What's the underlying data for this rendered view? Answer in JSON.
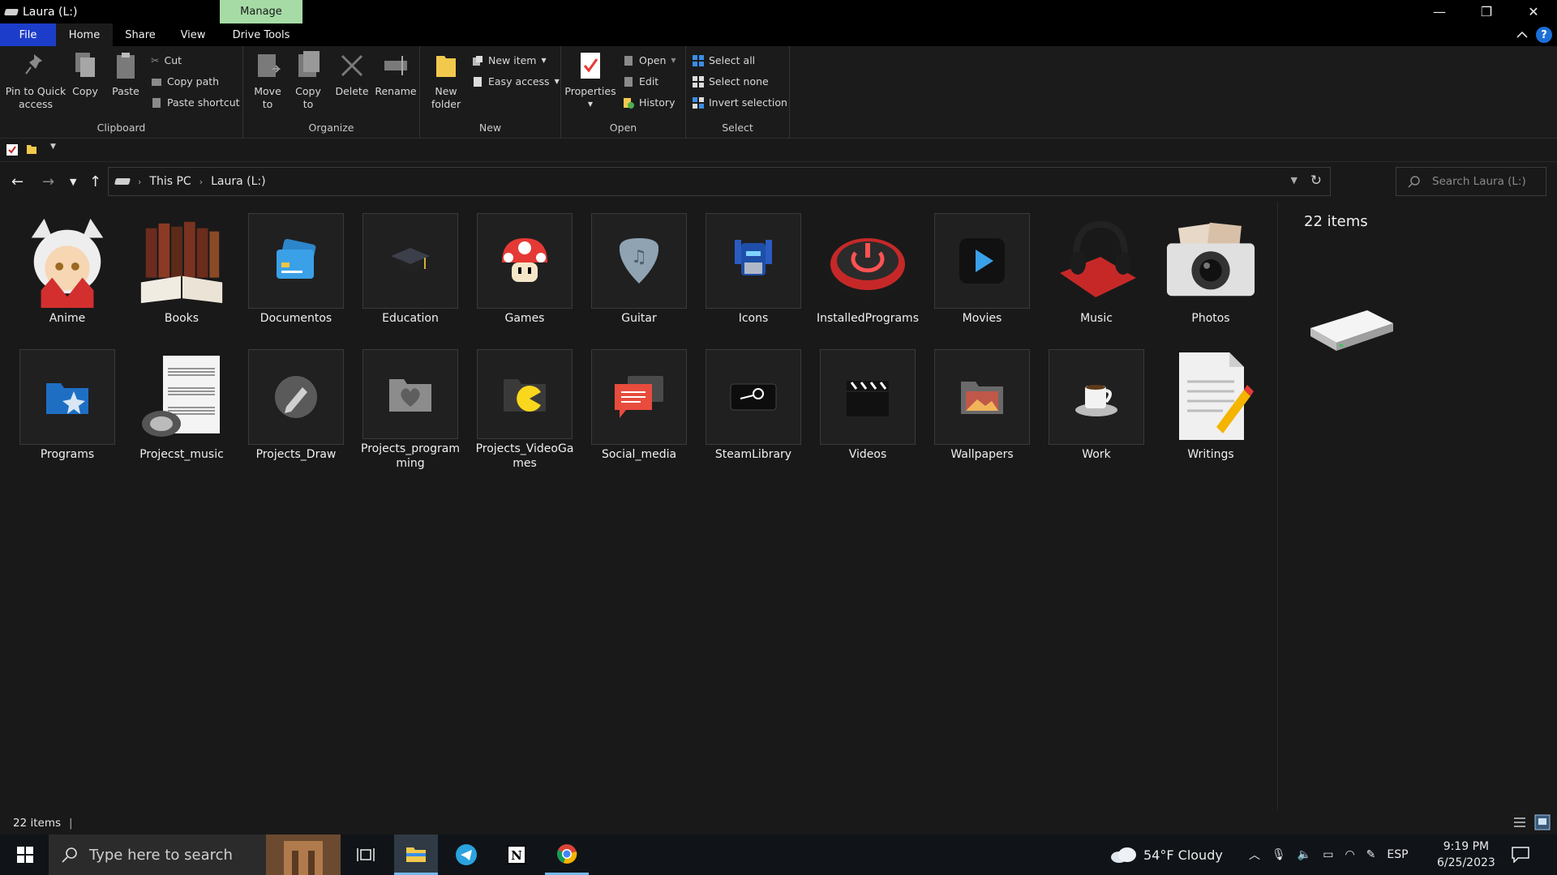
{
  "window": {
    "title": "Laura (L:)",
    "context_tab": "Manage",
    "minimize_glyph": "—",
    "maximize_glyph": "❐",
    "close_glyph": "✕"
  },
  "ribbon_tabs": [
    "File",
    "Home",
    "Share",
    "View",
    "Drive Tools"
  ],
  "ribbon": {
    "clipboard": {
      "label": "Clipboard",
      "pin_line1": "Pin to Quick",
      "pin_line2": "access",
      "copy": "Copy",
      "paste": "Paste",
      "cut": "Cut",
      "copy_path": "Copy path",
      "paste_shortcut": "Paste shortcut"
    },
    "organize": {
      "label": "Organize",
      "move_line1": "Move",
      "move_line2": "to",
      "copyto_line1": "Copy",
      "copyto_line2": "to",
      "delete": "Delete",
      "rename": "Rename"
    },
    "new": {
      "label": "New",
      "folder_line1": "New",
      "folder_line2": "folder",
      "new_item": "New item",
      "easy_access": "Easy access"
    },
    "open": {
      "label": "Open",
      "properties": "Properties",
      "open": "Open",
      "edit": "Edit",
      "history": "History"
    },
    "select": {
      "label": "Select",
      "select_all": "Select all",
      "select_none": "Select none",
      "invert": "Invert selection"
    }
  },
  "address": {
    "crumbs": [
      "This PC",
      "Laura (L:)"
    ],
    "search_placeholder": "Search Laura (L:)"
  },
  "items": [
    {
      "name": "Anime",
      "icon": "anime-character-icon"
    },
    {
      "name": "Books",
      "icon": "books-icon"
    },
    {
      "name": "Documentos",
      "icon": "id-card-icon"
    },
    {
      "name": "Education",
      "icon": "graduation-cap-icon"
    },
    {
      "name": "Games",
      "icon": "mushroom-icon"
    },
    {
      "name": "Guitar",
      "icon": "guitar-pick-icon"
    },
    {
      "name": "Icons",
      "icon": "robot-icon"
    },
    {
      "name": "InstalledPrograms",
      "icon": "power-button-icon"
    },
    {
      "name": "Movies",
      "icon": "play-icon"
    },
    {
      "name": "Music",
      "icon": "headphones-icon"
    },
    {
      "name": "Photos",
      "icon": "camera-icon"
    },
    {
      "name": "Programs",
      "icon": "programs-folder-icon"
    },
    {
      "name": "Projecst_music",
      "icon": "sheet-music-icon"
    },
    {
      "name": "Projects_Draw",
      "icon": "pencil-icon"
    },
    {
      "name": "Projects_programming",
      "icon": "heart-folder-icon"
    },
    {
      "name": "Projects_VideoGames",
      "icon": "pacman-folder-icon"
    },
    {
      "name": "Social_media",
      "icon": "chat-icon"
    },
    {
      "name": "SteamLibrary",
      "icon": "steam-icon"
    },
    {
      "name": "Videos",
      "icon": "clapperboard-icon"
    },
    {
      "name": "Wallpapers",
      "icon": "picture-folder-icon"
    },
    {
      "name": "Work",
      "icon": "coffee-cup-icon"
    },
    {
      "name": "Writings",
      "icon": "document-pencil-icon"
    }
  ],
  "details": {
    "count": "22 items"
  },
  "status": {
    "count": "22 items"
  },
  "taskbar": {
    "search_placeholder": "Type here to search",
    "weather": "54°F  Cloudy",
    "language": "ESP",
    "time": "9:19 PM",
    "date": "6/25/2023"
  },
  "colors": {
    "accent": "#1c3dc9",
    "manage_tab": "#a6dba6",
    "background": "#191919"
  }
}
